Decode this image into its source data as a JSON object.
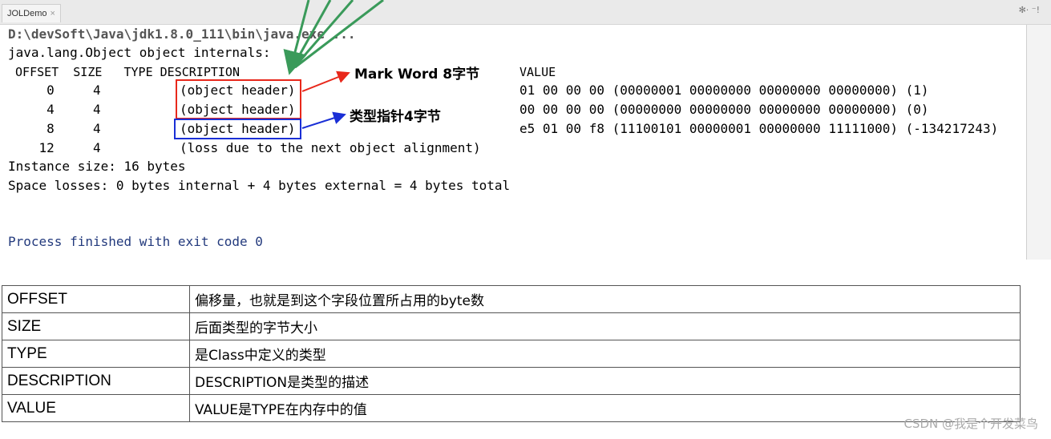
{
  "ide": {
    "tab_label": "JOLDemo",
    "tab_close": "×",
    "tools": "✻·  ⁻!",
    "console": {
      "cmd_line": "D:\\devSoft\\Java\\jdk1.8.0_111\\bin\\java.exe ...",
      "internals_line": "java.lang.Object object internals:",
      "header_line": " OFFSET  SIZE   TYPE DESCRIPTION",
      "value_header": "VALUE",
      "rows": [
        {
          "offset": "     0     4        ",
          "desc": "(object header)",
          "value": "01 00 00 00 (00000001 00000000 00000000 00000000) (1)"
        },
        {
          "offset": "     4     4        ",
          "desc": "(object header)",
          "value": "00 00 00 00 (00000000 00000000 00000000 00000000) (0)"
        },
        {
          "offset": "     8     4        ",
          "desc": "(object header)",
          "value": "e5 01 00 f8 (11100101 00000001 00000000 11111000) (-134217243)"
        },
        {
          "offset": "    12     4        ",
          "desc": "(loss due to the next object alignment)",
          "value": ""
        }
      ],
      "instance_size": "Instance size: 16 bytes",
      "space_losses": "Space losses: 0 bytes internal + 4 bytes external = 4 bytes total",
      "process_finished": "Process finished with exit code 0"
    },
    "annotations": {
      "mark_word": "Mark Word 8字节",
      "klass_pointer": "类型指针4字节",
      "red": "#e8281b",
      "blue": "#1a2fd6",
      "green": "#3a9a5a"
    }
  },
  "table": [
    {
      "key": "OFFSET",
      "value": "偏移量，也就是到这个字段位置所占用的byte数"
    },
    {
      "key": "SIZE",
      "value": "后面类型的字节大小"
    },
    {
      "key": "TYPE",
      "value": "是Class中定义的类型"
    },
    {
      "key": "DESCRIPTION",
      "value": "DESCRIPTION是类型的描述"
    },
    {
      "key": "VALUE",
      "value": "VALUE是TYPE在内存中的值"
    }
  ],
  "watermark": "CSDN @我是个开发菜鸟"
}
